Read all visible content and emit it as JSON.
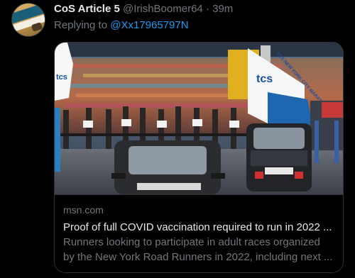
{
  "tweet": {
    "author_name": "CoS Article 5",
    "author_handle": "@IrishBoomer64",
    "separator": "·",
    "time": "39m",
    "replying_prefix": "Replying to ",
    "replying_to": "@Xx17965797N"
  },
  "card": {
    "domain": "msn.com",
    "title": "Proof of full COVID vaccination required to run in 2022 ...",
    "description_line1": "Runners looking to participate in adult races organized",
    "description_line2": "by the New York Road Runners in 2022, including next ...",
    "banner_left": "tcs",
    "banner_right_big": "tcs",
    "banner_right_small": "TCS NEW YORK CITY MARATHON"
  },
  "colors": {
    "background": "#000000",
    "text": "#e7e9ea",
    "muted": "#71767b",
    "link": "#1d9bf0",
    "border": "#2f3336"
  }
}
